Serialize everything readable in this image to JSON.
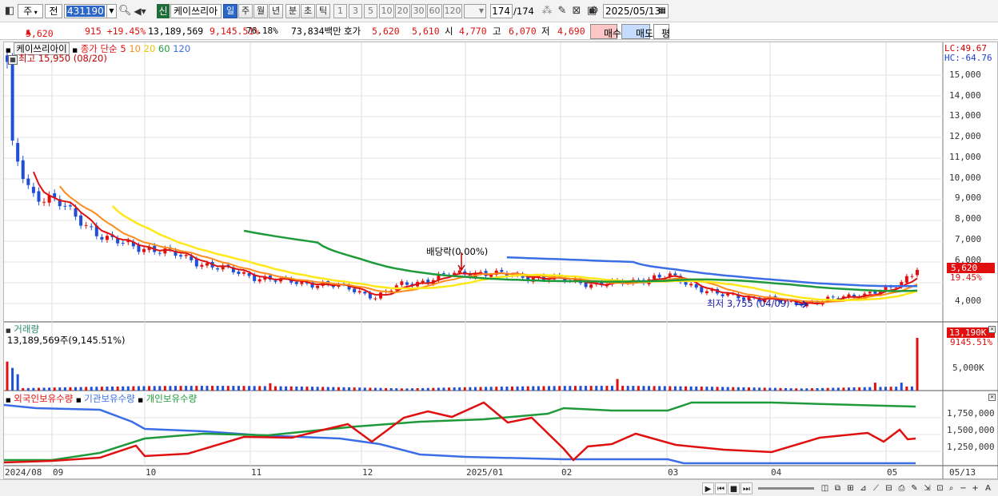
{
  "toolbar": {
    "market_mode": "주",
    "prev_label": "전",
    "code": "431190",
    "badge": "신",
    "stock_name": "케이쓰리아",
    "periods": [
      "일",
      "주",
      "월",
      "년",
      "분",
      "초",
      "틱"
    ],
    "active_period": "일",
    "intervals": [
      "1",
      "3",
      "5",
      "10",
      "20",
      "30",
      "60",
      "120"
    ],
    "count_value": "174",
    "count_total": "/174",
    "date": "2025/05/13"
  },
  "quote": {
    "price": "5,620",
    "change": "915 +19.45%",
    "volume": "13,189,569",
    "volume_ratio": "9,145.51%",
    "turnover": "76.18%",
    "amount": "73,834백만",
    "hoga_label": "호가",
    "ask": "5,620",
    "bid": "5,610",
    "open_label": "시",
    "open": "4,770",
    "high_label": "고",
    "high": "6,070",
    "low_label": "저",
    "low": "4,690",
    "buy_label": "매수",
    "sell_label": "매도",
    "eval_label": "평"
  },
  "price_panel": {
    "stock_name": "케이쓰리아이",
    "ma_label": "종가 단순",
    "ma_periods": [
      "5",
      "10",
      "20",
      "60",
      "120"
    ],
    "ma_colors": [
      "#e01010",
      "#ff8c1a",
      "#ffe81a",
      "#1f9a3a",
      "#3b6ee6"
    ],
    "high_marker": "최고 15,950 (08/20)",
    "low_marker": "최저 3,755 (04/09)",
    "dividend_marker": "배당락(0.00%)",
    "lc": "LC:49.67",
    "hc": "HC:-64.76",
    "y_ticks": [
      "15,000",
      "14,000",
      "13,000",
      "12,000",
      "11,000",
      "10,000",
      "9,000",
      "8,000",
      "7,000",
      "6,000",
      "4,000"
    ],
    "current_price_tag": "5,620",
    "current_change_tag": "19.45%"
  },
  "volume_panel": {
    "title": "거래량",
    "value": "13,189,569주(9,145.51%)",
    "tag": "13,190K",
    "tag2": "9145.51%",
    "y_tick": "5,000K"
  },
  "holding_panel": {
    "legends": [
      "외국인보유수량",
      "기관보유수량",
      "개인보유수량"
    ],
    "legend_colors": [
      "#e01010",
      "#3b6ee6",
      "#1f9a3a"
    ],
    "y_ticks": [
      "1,750,000",
      "1,500,000",
      "1,250,000"
    ]
  },
  "x_axis": {
    "labels": [
      "2024/08",
      "09",
      "10",
      "11",
      "12",
      "2025/01",
      "02",
      "03",
      "04",
      "05"
    ],
    "right_label": "05/13"
  },
  "chart_data": {
    "type": "candlestick",
    "x_range": [
      "2024/08",
      "2025/05/13"
    ],
    "price_ylim": [
      3500,
      16000
    ],
    "weekly_close": [
      12000,
      9300,
      8900,
      8000,
      7100,
      6800,
      6600,
      6300,
      5900,
      5600,
      5300,
      5100,
      5000,
      4900,
      4700,
      4300,
      4900,
      5100,
      5400,
      5500,
      5400,
      5300,
      5200,
      5100,
      4900,
      5000,
      5200,
      5300,
      4800,
      4400,
      4300,
      4200,
      4000,
      4100,
      4300,
      4500,
      4700,
      5620
    ],
    "highest": 15950,
    "lowest": 3755
  }
}
